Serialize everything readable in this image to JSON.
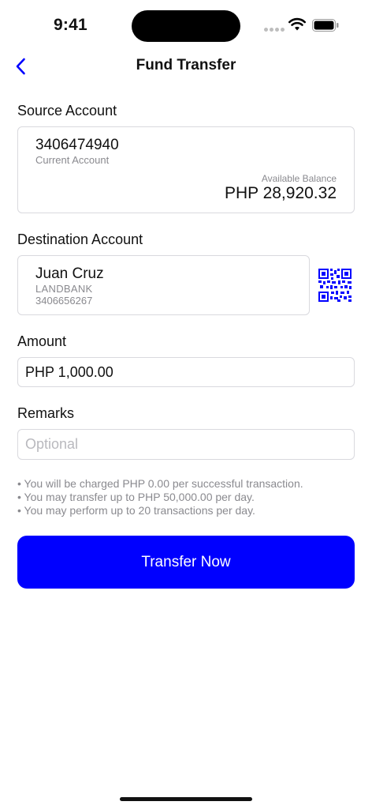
{
  "status_bar": {
    "time": "9:41"
  },
  "nav": {
    "title": "Fund Transfer",
    "back_icon": "chevron-left-icon"
  },
  "source": {
    "label": "Source Account",
    "account_number": "3406474940",
    "account_type": "Current Account",
    "balance_label": "Available Balance",
    "balance_value": "PHP 28,920.32"
  },
  "destination": {
    "label": "Destination Account",
    "name": "Juan Cruz",
    "bank": "LANDBANK",
    "account_number": "3406656267",
    "qr_icon": "qr-code-icon"
  },
  "amount": {
    "label": "Amount",
    "value": "PHP 1,000.00"
  },
  "remarks": {
    "label": "Remarks",
    "value": "",
    "placeholder": "Optional"
  },
  "notes": [
    "• You will be charged PHP 0.00 per successful transaction.",
    "• You may transfer up to PHP 50,000.00 per day.",
    "• You may perform up to 20 transactions per day."
  ],
  "button": {
    "label": "Transfer Now"
  },
  "colors": {
    "accent": "#0000ff",
    "border": "#d9d9de",
    "muted": "#8a8a8f"
  }
}
